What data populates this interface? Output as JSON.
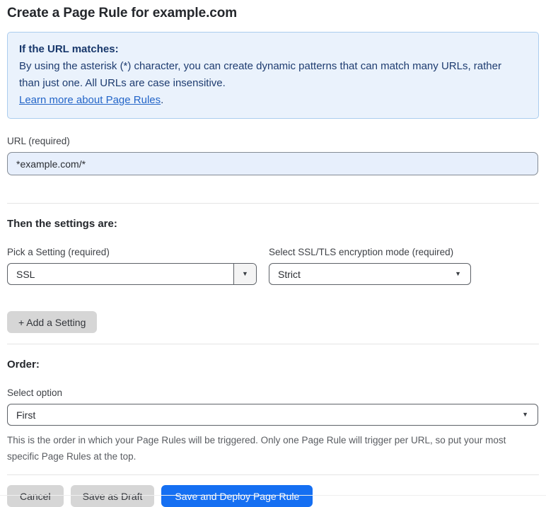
{
  "page": {
    "title": "Create a Page Rule for example.com"
  },
  "info_box": {
    "heading": "If the URL matches:",
    "body": "By using the asterisk (*) character, you can create dynamic patterns that can match many URLs, rather than just one. All URLs are case insensitive.",
    "link": "Learn more about Page Rules",
    "link_suffix": "."
  },
  "url_field": {
    "label": "URL (required)",
    "value": "*example.com/*"
  },
  "settings": {
    "heading": "Then the settings are:",
    "setting_select": {
      "label": "Pick a Setting (required)",
      "value": "SSL"
    },
    "mode_select": {
      "label": "Select SSL/TLS encryption mode (required)",
      "value": "Strict"
    },
    "add_button_label": "+ Add a Setting"
  },
  "order": {
    "heading": "Order:",
    "select_label": "Select option",
    "select_value": "First",
    "help_text": "This is the order in which your Page Rules will be triggered. Only one Page Rule will trigger per URL, so put your most specific Page Rules at the top."
  },
  "footer": {
    "cancel_label": "Cancel",
    "save_draft_label": "Save as Draft",
    "save_deploy_label": "Save and Deploy Page Rule"
  },
  "icons": {
    "caret_down": "▼"
  },
  "colors": {
    "accent_blue": "#156ff2",
    "info_background": "#eaf2fc",
    "info_border": "#abcdee",
    "info_text": "#1e3c70",
    "link_blue": "#2365c8",
    "url_input_background": "#e7effc",
    "gray_button": "#d6d6d6"
  }
}
